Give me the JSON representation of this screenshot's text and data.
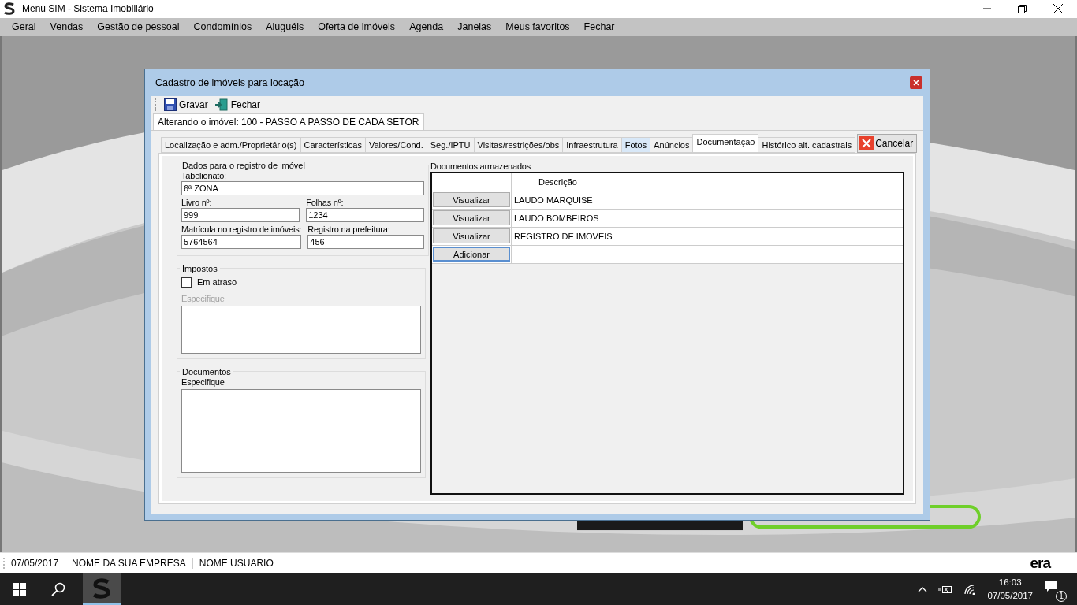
{
  "window": {
    "title": "Menu SIM - Sistema Imobiliário"
  },
  "menu": [
    "Geral",
    "Vendas",
    "Gestão de pessoal",
    "Condomínios",
    "Aluguéis",
    "Oferta de imóveis",
    "Agenda",
    "Janelas",
    "Meus favoritos",
    "Fechar"
  ],
  "dialog": {
    "title": "Cadastro de imóveis para locação",
    "toolbar": [
      {
        "label": "Gravar",
        "kind": "save"
      },
      {
        "label": "Fechar",
        "kind": "exit"
      }
    ],
    "record_tab": "Alterando o imóvel: 100 -  PASSO A PASSO DE CADA SETOR",
    "tabs": [
      {
        "label": "Localização e adm./Proprietário(s)",
        "selected": false,
        "hot": false
      },
      {
        "label": "Características",
        "selected": false,
        "hot": false
      },
      {
        "label": "Valores/Cond.",
        "selected": false,
        "hot": false
      },
      {
        "label": "Seg./IPTU",
        "selected": false,
        "hot": false
      },
      {
        "label": "Visitas/restrições/obs",
        "selected": false,
        "hot": false
      },
      {
        "label": "Infraestrutura",
        "selected": false,
        "hot": false
      },
      {
        "label": "Fotos",
        "selected": false,
        "hot": true
      },
      {
        "label": "Anúncios",
        "selected": false,
        "hot": false
      },
      {
        "label": "Documentação",
        "selected": true,
        "hot": false
      },
      {
        "label": "Histórico alt. cadastrais",
        "selected": false,
        "hot": false
      }
    ],
    "cancel_button": "Cancelar",
    "registro": {
      "title": "Dados para o registro de imóvel",
      "rows": [
        [
          {
            "label": "Tabelionato:",
            "value": "6ª ZONA"
          }
        ],
        [
          {
            "label": "Livro nº:",
            "value": "999"
          },
          {
            "label": "Folhas nº:",
            "value": "1234"
          }
        ],
        [
          {
            "label": "Matrícula no registro de imóveis:",
            "value": "5764564"
          },
          {
            "label": "Registro na prefeitura:",
            "value": "456"
          }
        ]
      ]
    },
    "impostos": {
      "title": "Impostos",
      "checkbox": {
        "label": "Em atraso",
        "checked": false
      },
      "specify": {
        "label": "Especifique",
        "disabled": true
      }
    },
    "documentos": {
      "title": "Documentos",
      "specify": {
        "label": "Especifique",
        "disabled": false
      }
    },
    "stored_docs": {
      "title": "Documentos armazenados",
      "column": "Descrição",
      "rows": [
        {
          "button": "Visualizar",
          "description": "LAUDO MARQUISE",
          "focused": false
        },
        {
          "button": "Visualizar",
          "description": "LAUDO BOMBEIROS",
          "focused": false
        },
        {
          "button": "Visualizar",
          "description": "REGISTRO DE IMOVEIS",
          "focused": false
        },
        {
          "button": "Adicionar",
          "focused": true
        }
      ]
    }
  },
  "status_bar": [
    "07/05/2017",
    "NOME DA SUA EMPRESA",
    "NOME USUARIO"
  ],
  "brand": "era",
  "taskbar": {
    "time": "16:03",
    "date": "07/05/2017",
    "notifications": "1"
  }
}
